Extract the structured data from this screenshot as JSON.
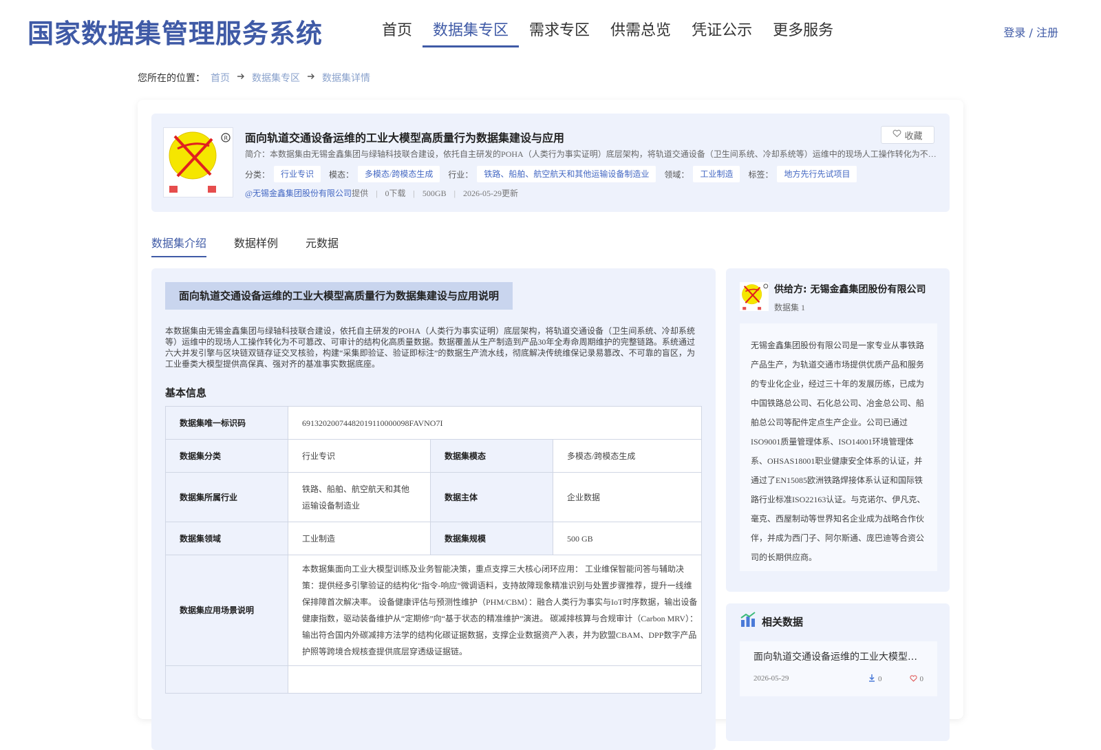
{
  "header": {
    "site_title": "国家数据集管理服务系统",
    "nav": [
      "首页",
      "数据集专区",
      "需求专区",
      "供需总览",
      "凭证公示",
      "更多服务"
    ],
    "active_nav_index": 1,
    "login_label": "登录 / 注册"
  },
  "breadcrumb": {
    "prefix": "您所在的位置：",
    "items": [
      "首页",
      "数据集专区",
      "数据集详情"
    ]
  },
  "dataset": {
    "title": "面向轨道交通设备运维的工业大模型高质量行为数据集建设与应用",
    "favorite_label": "收藏",
    "intro_label": "简介：",
    "intro": "本数据集由无锡金鑫集团与绿轴科技联合建设，依托自主研发的POHA（人类行为事实证明）底层架构，将轨道交通设备（卫生间系统、冷却系统等）运维中的现场人工操作转化为不可篡改、可审计的结构化高质量数据。",
    "tags": [
      {
        "label": "分类：",
        "value": "行业专识"
      },
      {
        "label": "模态：",
        "value": "多模态/跨模态生成"
      },
      {
        "label": "行业：",
        "value": "铁路、船舶、航空航天和其他运输设备制造业"
      },
      {
        "label": "领域：",
        "value": "工业制造"
      },
      {
        "label": "标签：",
        "value": "地方先行先试项目"
      }
    ],
    "provider_link": "@无锡金鑫集团股份有限公司",
    "provided_label": "提供",
    "downloads": "0下载",
    "size": "500GB",
    "updated": "2026-05-29更新"
  },
  "tabs": [
    "数据集介绍",
    "数据样例",
    "元数据"
  ],
  "active_tab_index": 0,
  "intro_section": {
    "title": "面向轨道交通设备运维的工业大模型高质量行为数据集建设与应用说明",
    "description": "本数据集由无锡金鑫集团与绿轴科技联合建设，依托自主研发的POHA（人类行为事实证明）底层架构，将轨道交通设备（卫生间系统、冷却系统等）运维中的现场人工操作转化为不可篡改、可审计的结构化高质量数据。数据覆盖从生产制造到产品30年全寿命周期维护的完整链路。系统通过六大并发引擎与区块链双链存证交叉核验，构建“采集即验证、验证即标注”的数据生产流水线，彻底解决传统维保记录易篡改、不可靠的盲区，为工业垂类大模型提供高保真、强对齐的基准事实数据底座。",
    "basic_info_title": "基本信息"
  },
  "basic_info": {
    "id_label": "数据集唯一标识码",
    "id_value": "69132020074482019110000098FAVNO7I",
    "category_label": "数据集分类",
    "category_value": "行业专识",
    "modality_label": "数据集模态",
    "modality_value": "多模态/跨模态生成",
    "industry_label": "数据集所属行业",
    "industry_value": "铁路、船舶、航空航天和其他运输设备制造业",
    "subject_label": "数据主体",
    "subject_value": "企业数据",
    "domain_label": "数据集领域",
    "domain_value": "工业制造",
    "scale_label": "数据集规模",
    "scale_value": "500 GB",
    "scenario_label": "数据集应用场景说明",
    "scenario_value": "本数据集面向工业大模型训练及业务智能决策，重点支撑三大核心闭环应用： 工业维保智能问答与辅助决策：提供经多引擎验证的结构化“指令-响应”微调语料，支持故障现象精准识别与处置步骤推荐，提升一线维保排障首次解决率。 设备健康评估与预测性维护（PHM/CBM）：融合人类行为事实与IoT时序数据，输出设备健康指数，驱动装备维护从“定期修”向“基于状态的精准维护”演进。 碳减排核算与合规审计（Carbon MRV）：输出符合国内外碳减排方法学的结构化碳证据数据，支撑企业数据资产入表，并为欧盟CBAM、DPP数字产品护照等跨境合规核查提供底层穿透级证据链。"
  },
  "provider": {
    "name": "供给方: 无锡金鑫集团股份有限公司",
    "dataset_count": "数据集 1",
    "description": "无锡金鑫集团股份有限公司是一家专业从事铁路产品生产，为轨道交通市场提供优质产品和服务的专业化企业，经过三十年的发展历练，已成为中国铁路总公司、石化总公司、冶金总公司、船舶总公司等配件定点生产企业。公司已通过ISO9001质量管理体系、ISO14001环境管理体系、OHSAS18001职业健康安全体系的认证，并通过了EN15085欧洲铁路焊接体系认证和国际铁路行业标准ISO22163认证。与克诺尔、伊凡克、毫克、西屋制动等世界知名企业成为战略合作伙伴，并成为西门子、阿尔斯通、庞巴迪等合资公司的长期供应商。"
  },
  "related": {
    "title": "相关数据",
    "items": [
      {
        "title": "面向轨道交通设备运维的工业大模型高质量行为数据集建设与应用",
        "date": "2026-05-29",
        "downloads": "0",
        "favorites": "0"
      }
    ]
  },
  "icons": {
    "favorite": "heart-icon",
    "breadcrumb_arrow": "arrow-right-icon",
    "related": "bar-chart-icon",
    "download": "download-icon"
  },
  "colors": {
    "brand": "#3f5aa6",
    "link": "#4468c3",
    "panel_bg": "#eef2fc"
  }
}
